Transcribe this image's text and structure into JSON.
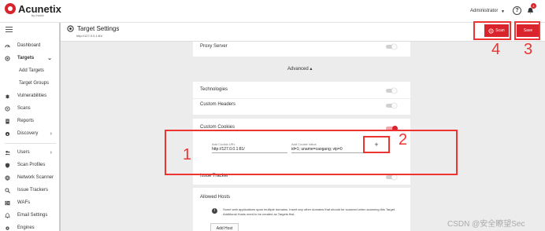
{
  "app": {
    "name": "Acunetix",
    "byline": "by Invicti"
  },
  "topbar": {
    "user": "Administrator",
    "notifications": "4"
  },
  "sidebar": {
    "items": [
      {
        "label": "Dashboard"
      },
      {
        "label": "Targets"
      },
      {
        "label": "Add Targets"
      },
      {
        "label": "Target Groups"
      },
      {
        "label": "Vulnerabilities"
      },
      {
        "label": "Scans"
      },
      {
        "label": "Reports"
      },
      {
        "label": "Discovery"
      },
      {
        "label": "Users"
      },
      {
        "label": "Scan Profiles"
      },
      {
        "label": "Network Scanner"
      },
      {
        "label": "Issue Trackers"
      },
      {
        "label": "WAFs"
      },
      {
        "label": "Email Settings"
      },
      {
        "label": "Engines"
      }
    ]
  },
  "header": {
    "title": "Target Settings",
    "url": "http://127.0.0.1:81/",
    "scan_label": "Scan",
    "save_label": "Save"
  },
  "settings": {
    "proxy_server": "Proxy Server",
    "advanced": "Advanced",
    "technologies": "Technologies",
    "custom_headers": "Custom Headers",
    "custom_cookies": "Custom Cookies",
    "issue_tracker": "Issue Tracker",
    "allowed_hosts": "Allowed Hosts",
    "allowed_hosts_info": "Some web applications span multiple domains. Insert any other domains that should be scanned when scanning this Target. Additional Hosts need to be created as Targets first.",
    "add_host": "Add Host"
  },
  "cookie_form": {
    "url_label": "Add Cookie URL",
    "url_value": "http://127.0.0.1:81/",
    "value_label": "Add Cookie Value",
    "value_value": "id=1; uname=caogang; vip=0",
    "add_button": "+"
  },
  "annotations": [
    "1",
    "2",
    "3",
    "4"
  ],
  "watermark": "CSDN @安全瞭望Sec",
  "colors": {
    "accent": "#d9232d",
    "annotation": "#ee3333"
  }
}
